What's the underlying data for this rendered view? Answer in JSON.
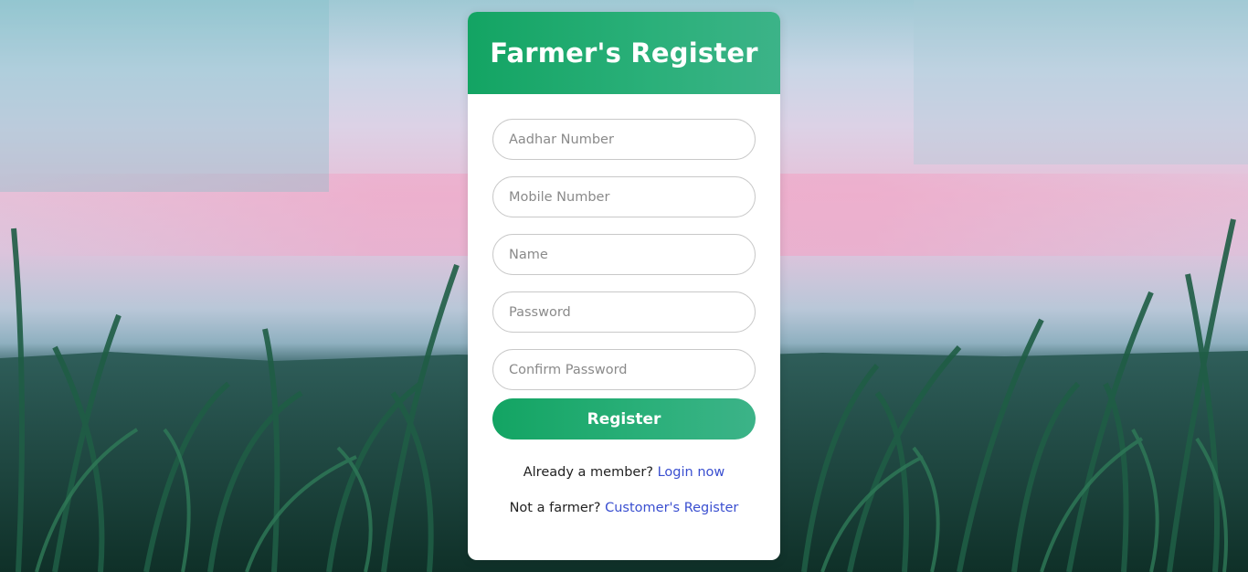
{
  "colors": {
    "accent_start": "#13a463",
    "accent_end": "#3cb388",
    "link": "#3a4fd0",
    "card_bg": "#ffffff"
  },
  "background": {
    "icon": "cornfield-sunset-photo"
  },
  "form": {
    "title": "Farmer's Register",
    "fields": {
      "aadhar": {
        "placeholder": "Aadhar Number",
        "value": ""
      },
      "mobile": {
        "placeholder": "Mobile Number",
        "value": ""
      },
      "name": {
        "placeholder": "Name",
        "value": ""
      },
      "password": {
        "placeholder": "Password",
        "value": ""
      },
      "confirm_password": {
        "placeholder": "Confirm Password",
        "value": ""
      }
    },
    "submit_label": "Register",
    "member_prompt": "Already a member?",
    "login_link": "Login now",
    "farmer_prompt": "Not a farmer?",
    "customer_link": "Customer's Register"
  }
}
